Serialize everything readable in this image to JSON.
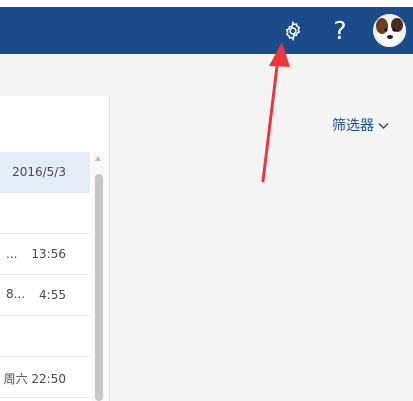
{
  "header": {
    "settings_icon": "gear-icon",
    "help_label": "?",
    "avatar_icon": "avatar"
  },
  "list": {
    "filter_label": "筛选器",
    "rows": [
      {
        "time": "2016/5/3",
        "selected": true
      },
      {
        "time": ""
      },
      {
        "prefix": "...",
        "time": "13:56"
      },
      {
        "prefix": "8...",
        "time": "4:55"
      },
      {
        "time": ""
      },
      {
        "time": "周六 22:50"
      }
    ]
  },
  "colors": {
    "header": "#1c4b8c",
    "accent": "#1c4b8c",
    "annotation_arrow": "#e8383d"
  }
}
